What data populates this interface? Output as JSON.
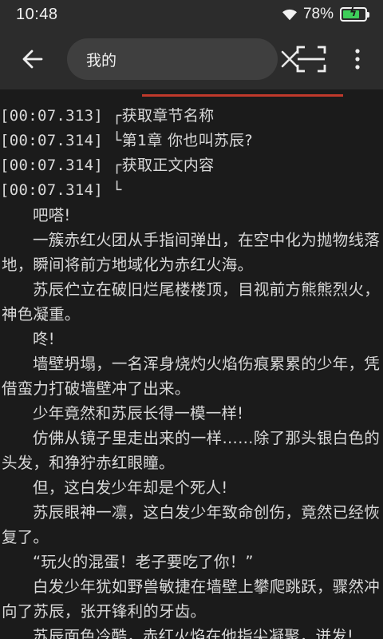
{
  "status_bar": {
    "time": "10:48",
    "battery_percent": "78%",
    "battery_level": 0.78,
    "battery_color": "#3ecf5a"
  },
  "toolbar": {
    "back_icon": "arrow-left",
    "search_value": "我的",
    "clear_icon": "close",
    "scan_icon": "scan",
    "more_icon": "more-vertical"
  },
  "log": [
    {
      "time": "[00:07.313]",
      "tree": "┌",
      "text": "获取章节名称"
    },
    {
      "time": "[00:07.314]",
      "tree": "└",
      "text": "第1章 你也叫苏辰?"
    },
    {
      "time": "[00:07.314]",
      "tree": "┌",
      "text": "获取正文内容"
    },
    {
      "time": "[00:07.314]",
      "tree": "└",
      "text": ""
    }
  ],
  "paragraphs": [
    "吧嗒!",
    "一簇赤红火团从手指间弹出，在空中化为抛物线落地，瞬间将前方地域化为赤红火海。",
    "苏辰伫立在破旧烂尾楼楼顶，目视前方熊熊烈火，神色凝重。",
    "咚!",
    "墙壁坍塌，一名浑身烧灼火焰伤痕累累的少年，凭借蛮力打破墙壁冲了出来。",
    "少年竟然和苏辰长得一模一样!",
    "仿佛从镜子里走出来的一样……除了那头银白色的头发，和狰狞赤红眼瞳。",
    "但，这白发少年却是个死人!",
    "苏辰眼神一凛，这白发少年致命创伤，竟然已经恢复了。",
    "“玩火的混蛋！老子要吃了你！”",
    "白发少年犹如野兽敏捷在墙壁上攀爬跳跃，骤然冲向了苏辰，张开锋利的牙齿。",
    "苏辰面色冷酷，赤红火焰在他指尖凝聚，迸发!"
  ]
}
